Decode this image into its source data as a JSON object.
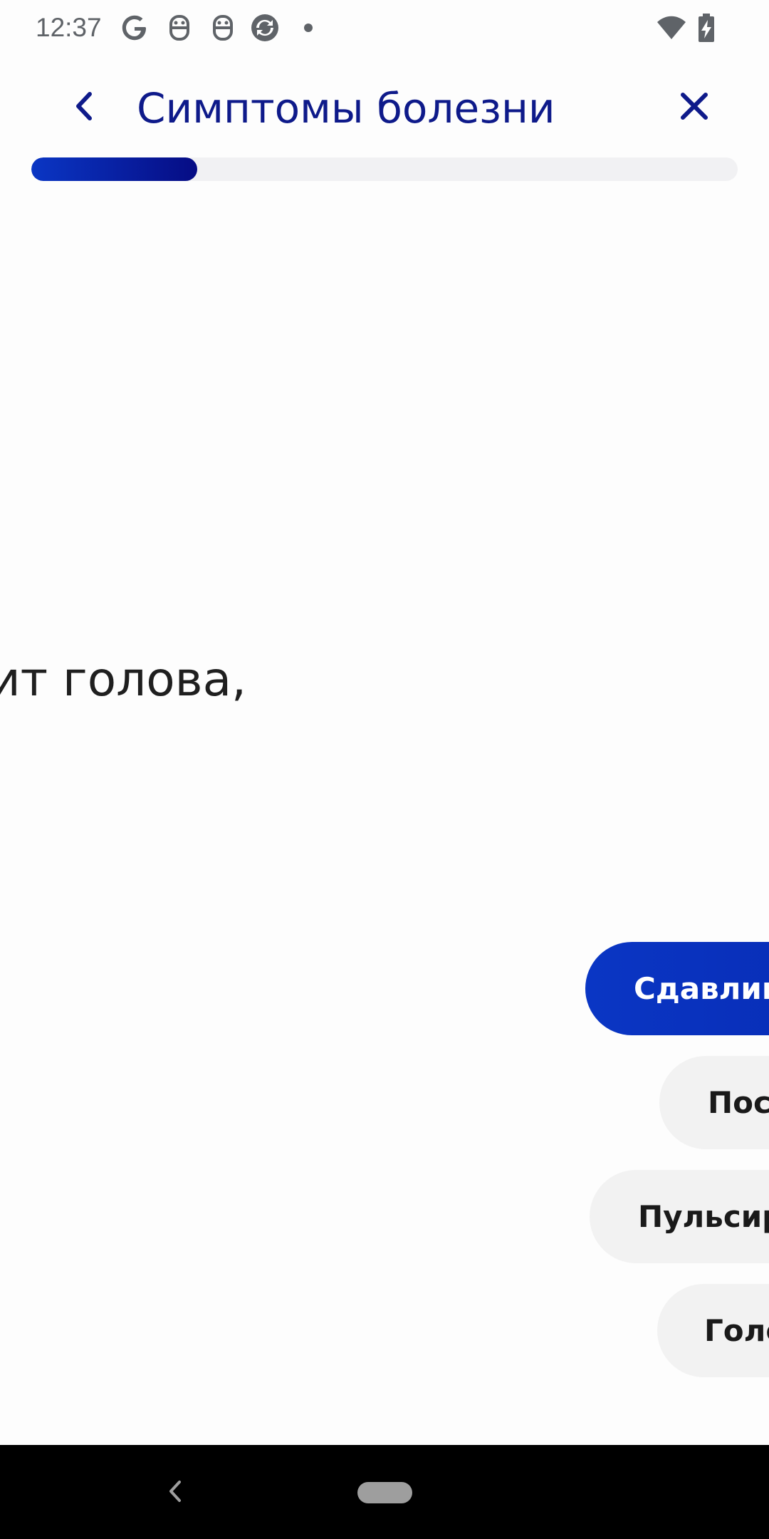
{
  "status_bar": {
    "time": "12:37",
    "icons": [
      "google-icon",
      "notification-icon",
      "notification-icon",
      "sync-icon",
      "dot-icon",
      "wifi-icon",
      "battery-charging-icon"
    ]
  },
  "header": {
    "title": "Симптомы болезни",
    "back_icon": "chevron-left-icon",
    "close_icon": "close-icon"
  },
  "progress": {
    "value": 0.235,
    "colors": {
      "start": "#0a36c4",
      "end": "#060c84",
      "track": "#f1f1f3"
    }
  },
  "question": {
    "text": "ит голова,"
  },
  "answers": [
    {
      "label": "Сдавлива",
      "selected": true
    },
    {
      "label": "Пост",
      "selected": false
    },
    {
      "label": "Пульсиру",
      "selected": false
    },
    {
      "label": "Голо",
      "selected": false
    }
  ],
  "nav_bar": {
    "icons": [
      "back-nav-icon",
      "home-pill-icon"
    ]
  },
  "colors": {
    "accent": "#0e1a8a",
    "chip_bg": "#f2f2f2",
    "selected_chip": "#0a36c4"
  }
}
